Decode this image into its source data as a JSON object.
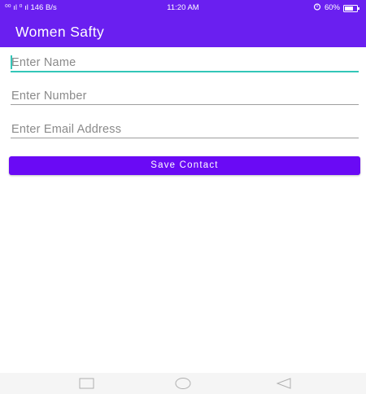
{
  "status_bar": {
    "signal_text": "⁰⁰ ıl ⁰ ıl 146 B/s",
    "time": "11:20 AM",
    "battery_text": "60%",
    "icons": [
      "signal-icon",
      "alarm-icon",
      "battery-icon"
    ]
  },
  "app_bar": {
    "title": "Women Safty",
    "color": "#6a1ff0"
  },
  "form": {
    "name_placeholder": "Enter Name",
    "number_placeholder": "Enter Number",
    "email_placeholder": "Enter Email Address",
    "save_label": "Save Contact",
    "focus_color": "#33c6b8",
    "button_color": "#6a0af5"
  },
  "nav_bar": {
    "icons": [
      "recents-square-icon",
      "home-circle-icon",
      "back-triangle-icon"
    ]
  }
}
